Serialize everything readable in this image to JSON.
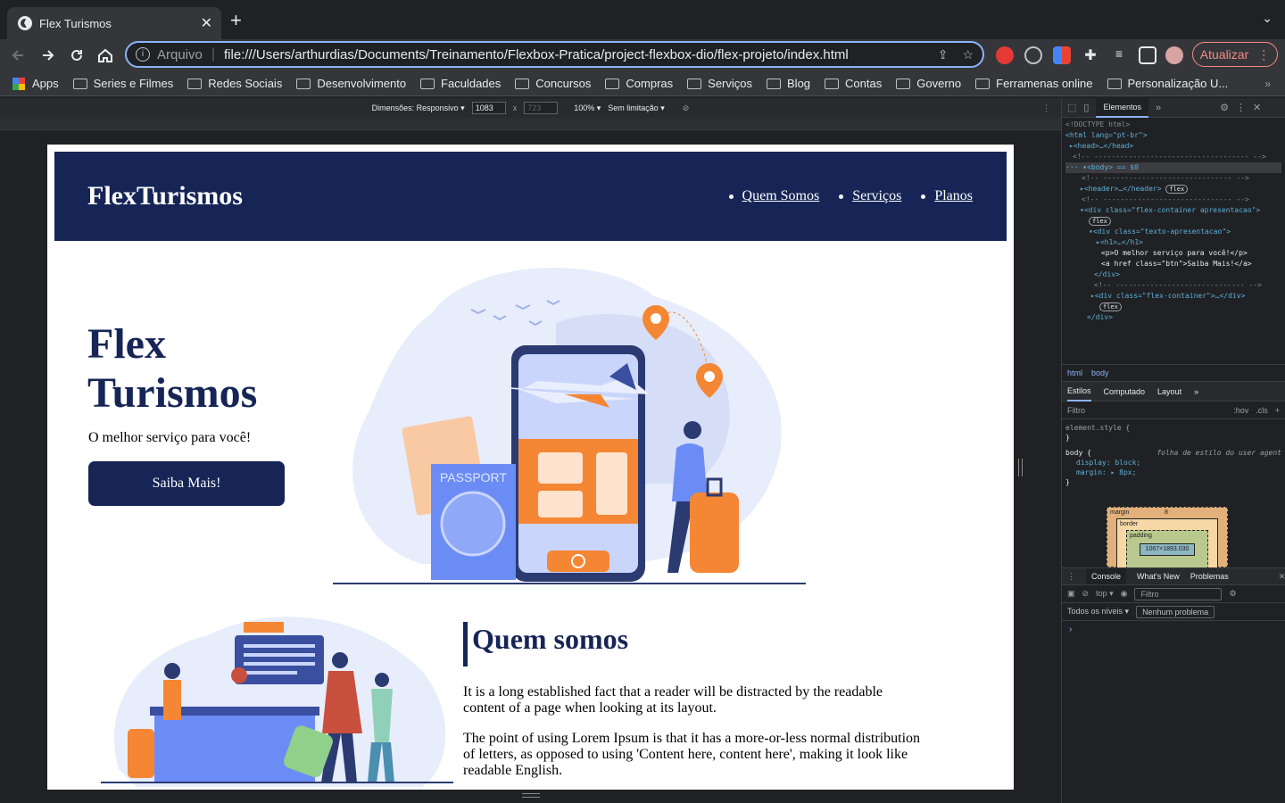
{
  "browser": {
    "tab_title": "Flex Turismos",
    "close_glyph": "✕",
    "new_tab_glyph": "+",
    "tab_menu_glyph": "⌄",
    "scheme_label": "Arquivo",
    "url": "file:///Users/arthurdias/Documents/Treinamento/Flexbox-Pratica/project-flexbox-dio/flex-projeto/index.html",
    "update_label": "Atualizar",
    "icons": [
      "back-icon",
      "forward-icon",
      "reload-icon",
      "home-icon",
      "info-icon",
      "share-icon",
      "star-icon",
      "extensions-icon",
      "reading-list-icon",
      "side-panel-icon",
      "avatar",
      "kebab-icon"
    ]
  },
  "bookmarks": [
    "Apps",
    "Series e Filmes",
    "Redes Sociais",
    "Desenvolvimento",
    "Faculdades",
    "Concursos",
    "Compras",
    "Serviços",
    "Blog",
    "Contas",
    "Governo",
    "Ferramenas online",
    "Personalização U..."
  ],
  "devbar": {
    "dimensions_label": "Dimensões: Responsivo ▾",
    "width": "1083",
    "times": "x",
    "height": "723",
    "zoom": "100% ▾",
    "throttle": "Sem limitação ▾"
  },
  "site": {
    "logo": "FlexTurismos",
    "nav": [
      "Quem Somos",
      "Serviços",
      "Planos"
    ],
    "hero_title": "Flex Turismos",
    "hero_text": "O melhor serviço para você!",
    "hero_button": "Saiba Mais!",
    "passport_label": "PASSPORT",
    "about_title": "Quem somos",
    "about_p1": "It is a long established fact that a reader will be distracted by the readable content of a page when looking at its layout.",
    "about_p2": "The point of using Lorem Ipsum is that it has a more-or-less normal distribution of letters, as opposed to using 'Content here, content here', making it look like readable English."
  },
  "devtools": {
    "tab_elements": "Elementos",
    "crumb_html": "html",
    "crumb_body": "body",
    "sub_styles": "Estilos",
    "sub_computed": "Computado",
    "sub_layout": "Layout",
    "filter_placeholder": "Filtro",
    "hov": ":hov",
    "cls": ".cls",
    "element_style": "element.style {",
    "close_brace": "}",
    "body_rule": "body {",
    "ua_label": "folha de estilo do user agent",
    "prop_display": "display: block;",
    "prop_margin": "margin: ▸ 8px;",
    "bm_margin": "margin",
    "bm_border": "border",
    "bm_padding": "padding",
    "bm_size": "1067×1893.030",
    "bm_eight": "8",
    "console_tab": "Console",
    "whats_new_tab": "What's New",
    "problems_tab": "Problemas",
    "context": "top ▾",
    "console_filter": "Filtro",
    "levels": "Todos os níveis ▾",
    "no_issues": "Nenhum problema",
    "prompt": "›",
    "dom_lines": [
      "<!DOCTYPE html>",
      "<html lang=\"pt-br\">",
      "▸<head>…</head>",
      "<!-- ------------------------------------ -->",
      "··· ▾<body> == $0",
      "<!-- ------------------------------ -->",
      "▸<header>…</header>",
      "<!-- ------------------------------ -->",
      "▾<div class=\"flex-container apresentacao\">",
      "▾<div class=\"texto-apresentacao\">",
      "▸<h1>…</h1>",
      "<p>O melhor serviço para você!</p>",
      "<a href class=\"btn\">Saiba Mais!</a>",
      "</div>",
      "<!-- ------------------------------ -->",
      "▸<div class=\"flex-container\">…</div>",
      "</div>"
    ],
    "flex_badge": "flex"
  },
  "colors": {
    "brand_navy": "#162556",
    "accent_orange": "#f58634",
    "illustration_blue": "#6c8cf5"
  }
}
